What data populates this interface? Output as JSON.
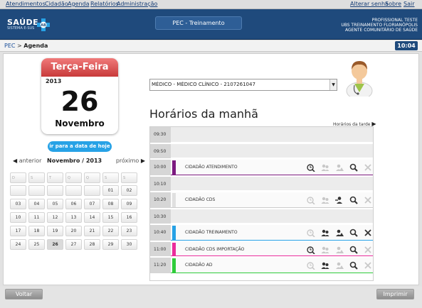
{
  "topmenu": {
    "left": [
      "Atendimentos",
      "Cidadão",
      "Agenda",
      "Relatórios",
      "Administração"
    ],
    "right": [
      "Alterar senha",
      "Sobre",
      "Sair"
    ]
  },
  "banner": {
    "logo_text": "SAÚDE",
    "logo_sub": "SISTEMA E-SUS",
    "logo_badge": "AB",
    "env": "PEC - Treinamento",
    "user": [
      "PROFISSIONAL TESTE",
      "UBS TREINAMENTO FLORIANÓPOLIS",
      "AGENTE COMUNITÁRIO DE SAÚDE"
    ]
  },
  "breadcrumb": {
    "home": "PEC",
    "separator": " > ",
    "current": "Agenda"
  },
  "clock": "10:04",
  "calendar": {
    "weekday": "Terça-Feira",
    "year": "2013",
    "day": "26",
    "month": "Novembro"
  },
  "today_button": "ir para a data de hoje",
  "month_nav": {
    "prev": "anterior",
    "month": "Novembro / 2013",
    "next": "próximo"
  },
  "month_grid": {
    "headers": [
      "D",
      "S",
      "T",
      "Q",
      "Q",
      "S",
      "S"
    ],
    "weeks": [
      [
        "",
        "",
        "",
        "",
        "",
        "01",
        "02"
      ],
      [
        "03",
        "04",
        "05",
        "06",
        "07",
        "08",
        "09"
      ],
      [
        "10",
        "11",
        "12",
        "13",
        "14",
        "15",
        "16"
      ],
      [
        "17",
        "18",
        "19",
        "20",
        "21",
        "22",
        "23"
      ],
      [
        "24",
        "25",
        "26",
        "27",
        "28",
        "29",
        "30"
      ]
    ],
    "selected": "26"
  },
  "professional_select": "MÉDICO - MÉDICO CLÍNICO - 2107261047",
  "schedule": {
    "title": "Horários da manhã",
    "afternoon_link": "Horários da tarde",
    "slots": [
      {
        "time": "09:30",
        "patient": "",
        "color": "",
        "icons": []
      },
      {
        "time": "09:50",
        "patient": "",
        "color": "",
        "icons": []
      },
      {
        "time": "10:00",
        "patient": "CIDADÃO ATENDIMENTO",
        "color": "#7c1a80",
        "icons": [
          "clock-check-icon",
          "user-move-icon-disabled",
          "user-warning-icon-disabled",
          "search-icon",
          "cancel-icon-disabled"
        ]
      },
      {
        "time": "10:10",
        "patient": "",
        "color": "",
        "icons": []
      },
      {
        "time": "10:20",
        "patient": "CIDADÃO CDS",
        "color": "#e0e0e0",
        "icons": [
          "clock-check-icon-disabled",
          "user-move-icon-disabled",
          "user-forward-icon",
          "search-icon",
          "cancel-icon-disabled"
        ]
      },
      {
        "time": "10:30",
        "patient": "",
        "color": "",
        "icons": []
      },
      {
        "time": "10:40",
        "patient": "CIDADÃO TREINAMENTO",
        "color": "#27a2e6",
        "icons": [
          "clock-check-icon-disabled",
          "user-move-icon",
          "user-warning-icon",
          "search-icon",
          "cancel-icon"
        ]
      },
      {
        "time": "11:00",
        "patient": "CIDADÃO CDS IMPORTAÇÃO",
        "color": "#ea2c9b",
        "icons": [
          "clock-check-icon",
          "user-move-icon-disabled",
          "user-warning-icon-disabled",
          "search-icon",
          "cancel-icon-disabled"
        ]
      },
      {
        "time": "11:20",
        "patient": "CIDADÃO AD",
        "color": "#2ecc3a",
        "icons": [
          "clock-check-icon-disabled",
          "user-move-icon",
          "user-warning-icon-disabled",
          "search-icon",
          "cancel-icon-disabled"
        ]
      }
    ]
  },
  "footer": {
    "back": "Voltar",
    "print": "Imprimir"
  },
  "colors": {
    "navy": "#1f4a7c",
    "accent": "#27a2e6",
    "red": "#c83a3a"
  }
}
